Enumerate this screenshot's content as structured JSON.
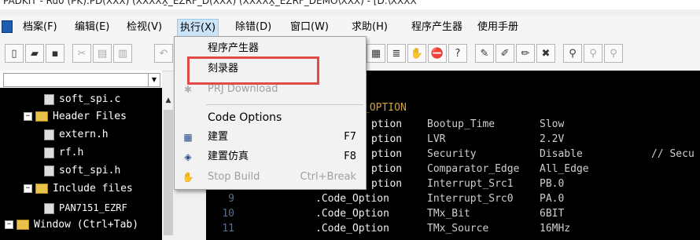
{
  "window": {
    "title_fragment": "PADKIT - Ru0 (PK).PD(XXX) (XXXXX̱_EZRF_D(XXX) (XXXXX̱_EZRF_DEMO\\XXX) - [D:\\XXXX"
  },
  "menubar": {
    "items": [
      {
        "label": "档案(F)"
      },
      {
        "label": "编辑(E)"
      },
      {
        "label": "检视(V)"
      },
      {
        "label": "执行(X)"
      },
      {
        "label": "除错(D)"
      },
      {
        "label": "窗口(W)"
      },
      {
        "label": "求助(H)"
      },
      {
        "label": "程序产生器"
      },
      {
        "label": "使用手册"
      }
    ]
  },
  "run_menu": {
    "items": [
      {
        "label": "程序产生器",
        "shortcut": "",
        "icon": "",
        "disabled": false
      },
      {
        "label": "刻录器",
        "shortcut": "",
        "icon": "",
        "disabled": false
      },
      {
        "label": "PRJ Download",
        "shortcut": "",
        "icon": "download-icon",
        "disabled": true
      },
      {
        "label": "Code Options",
        "shortcut": "",
        "icon": "",
        "disabled": false
      },
      {
        "label": "建置",
        "shortcut": "F7",
        "icon": "build-icon",
        "disabled": false
      },
      {
        "label": "建置仿真",
        "shortcut": "F8",
        "icon": "build-emulate-icon",
        "disabled": false
      },
      {
        "label": "Stop Build",
        "shortcut": "Ctrl+Break",
        "icon": "stop-build-icon",
        "disabled": true
      }
    ]
  },
  "project_tree": {
    "rows": [
      {
        "label": "soft_spi.c",
        "kind": "file",
        "expander": ""
      },
      {
        "label": "Header Files",
        "kind": "folder",
        "expander": "−"
      },
      {
        "label": "extern.h",
        "kind": "file",
        "expander": ""
      },
      {
        "label": "rf.h",
        "kind": "file",
        "expander": ""
      },
      {
        "label": "soft_spi.h",
        "kind": "file",
        "expander": ""
      },
      {
        "label": "Include files",
        "kind": "folder",
        "expander": "−"
      },
      {
        "label": "PAN7151_EZRF",
        "kind": "file",
        "expander": ""
      },
      {
        "label": "Window (Ctrl+Tab)",
        "kind": "folder",
        "expander": "−"
      }
    ]
  },
  "editor": {
    "header_fragment": "_OPTION",
    "lines": [
      {
        "num": "",
        "opt": "ption",
        "key": "Bootup_Time",
        "val": "Slow",
        "comment": ""
      },
      {
        "num": "",
        "opt": "ption",
        "key": "LVR",
        "val": "2.2V",
        "comment": ""
      },
      {
        "num": "",
        "opt": "ption",
        "key": "Security",
        "val": "Disable",
        "comment": "// Secu"
      },
      {
        "num": "",
        "opt": "ption",
        "key": "Comparator_Edge",
        "val": "All_Edge",
        "comment": ""
      },
      {
        "num": "",
        "opt": "ption",
        "key": "Interrupt_Src1",
        "val": "PB.0",
        "comment": ""
      },
      {
        "num": "9",
        "opt": ".Code_Option",
        "key": "Interrupt_Src0",
        "val": "PA.0",
        "comment": ""
      },
      {
        "num": "10",
        "opt": ".Code_Option",
        "key": "TMx_Bit",
        "val": "6BIT",
        "comment": ""
      },
      {
        "num": "11",
        "opt": ".Code_Option",
        "key": "TMx_Source",
        "val": "16MHz",
        "comment": ""
      }
    ]
  },
  "colors": {
    "menu_active_bg": "#cce4f7",
    "highlight_box": "#e24a45",
    "editor_bg": "#000000"
  }
}
